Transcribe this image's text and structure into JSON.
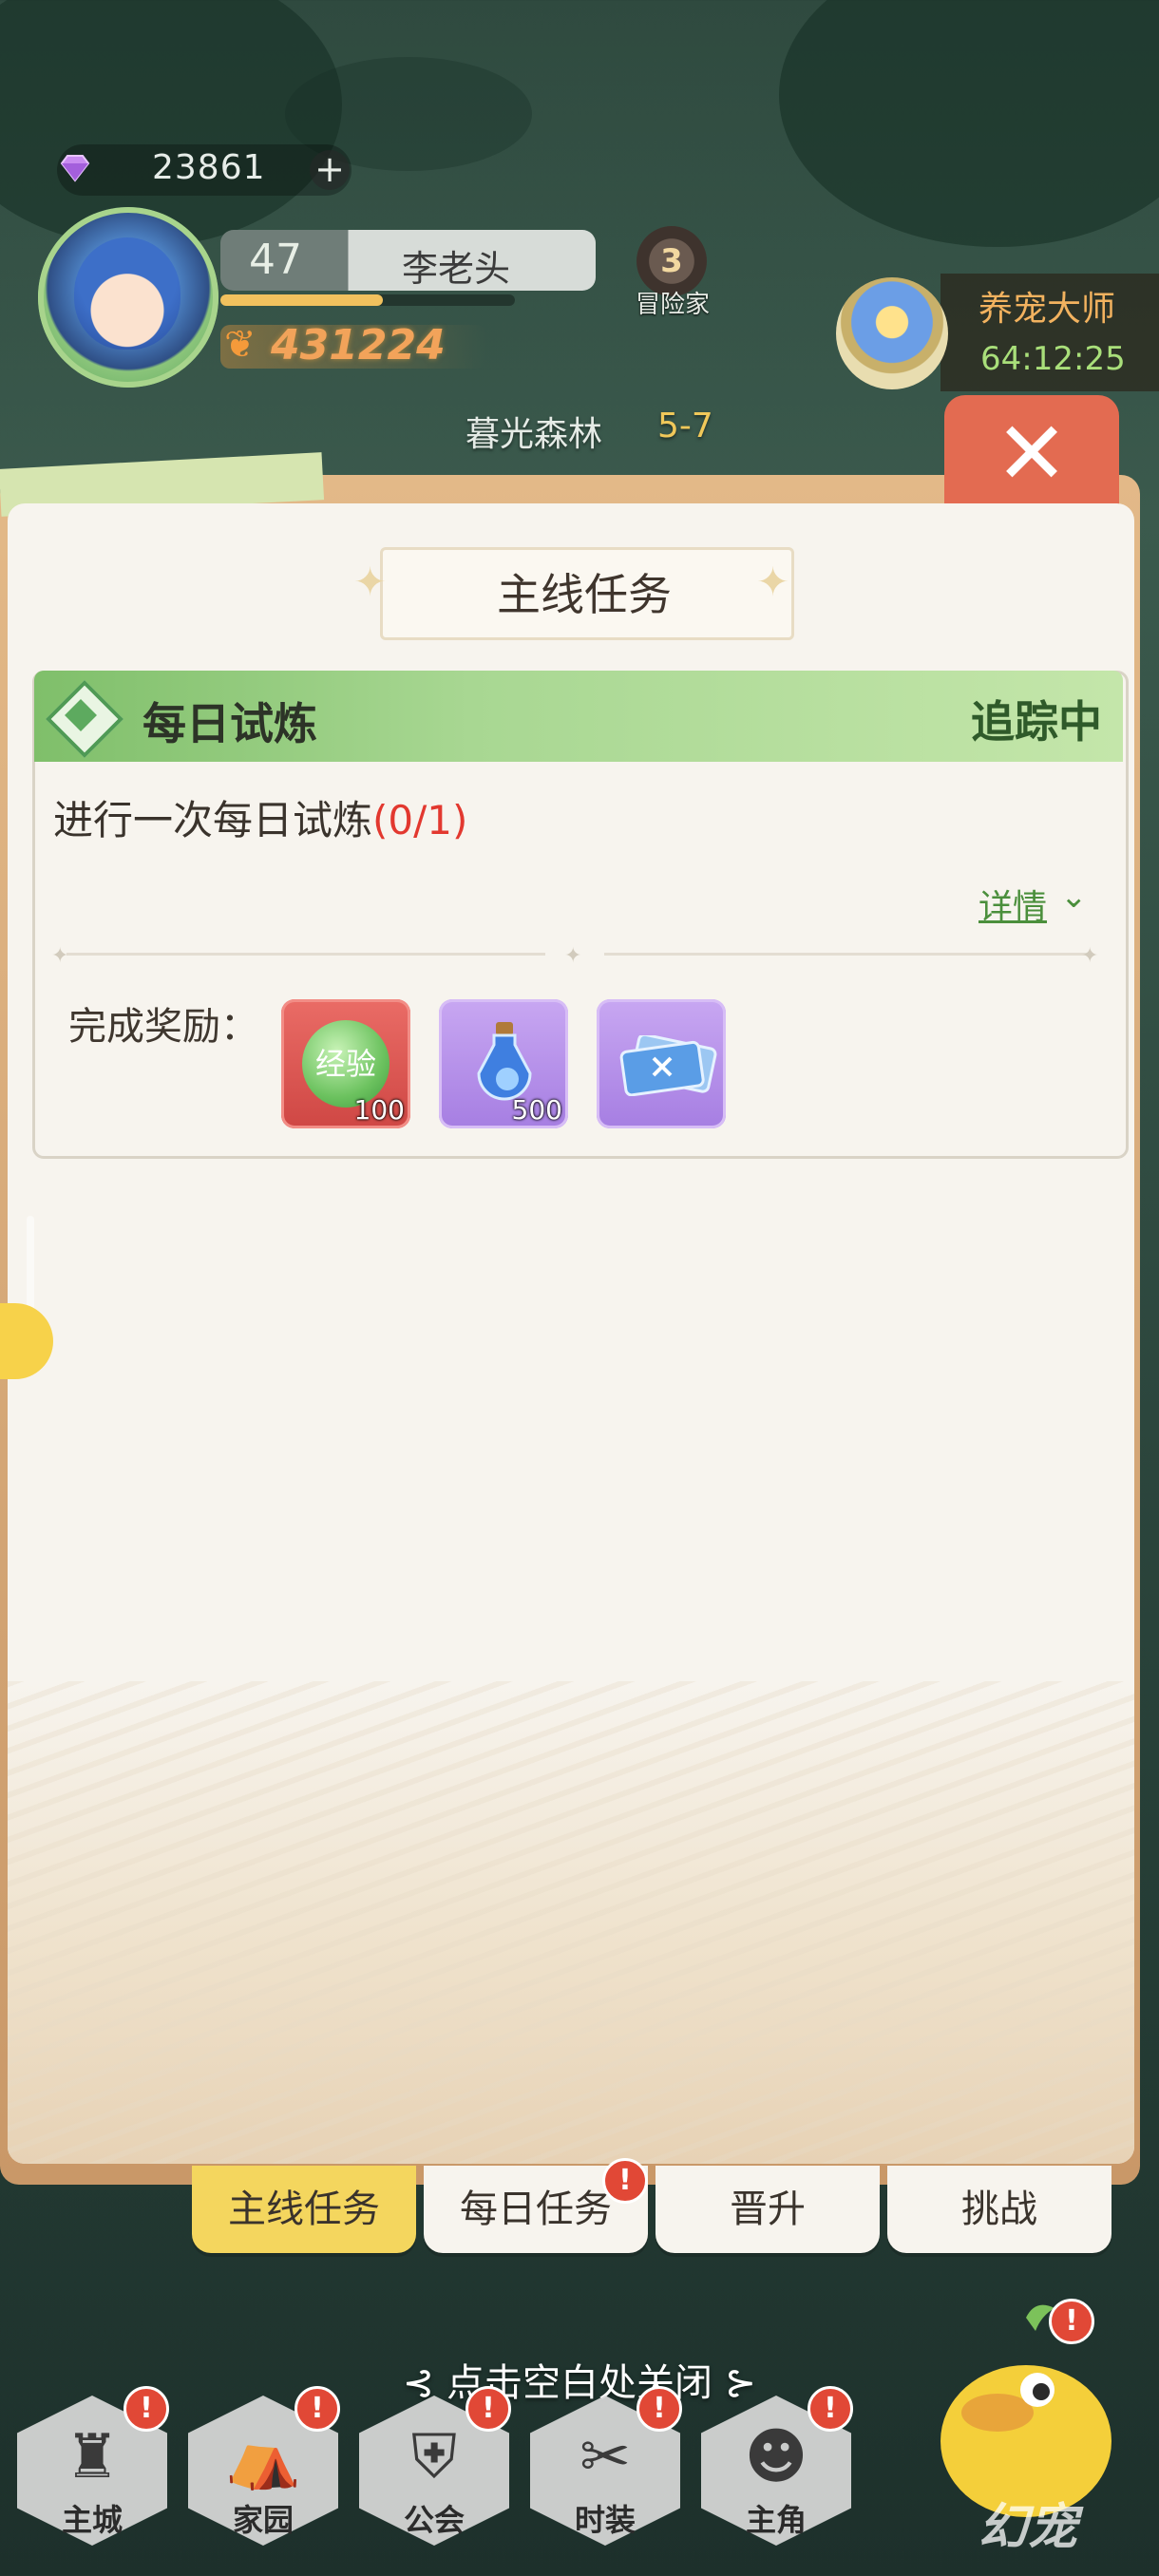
{
  "hud": {
    "gems": "23861",
    "plus": "+",
    "level": "47",
    "player_name": "李老头",
    "exp_fraction": 0.55,
    "power": "431224",
    "badge_number": "3",
    "badge_label": "冒险家",
    "stage_name": "暮光森林",
    "stage_num": "5-7"
  },
  "pet_event": {
    "title": "养宠大师",
    "timer": "64:12:25"
  },
  "close_button": "✕",
  "panel": {
    "title": "主线任务",
    "quest": {
      "name": "每日试炼",
      "status": "追踪中",
      "description": "进行一次每日试炼",
      "progress": "(0/1)",
      "details": "详情",
      "reward_label": "完成奖励：",
      "rewards": [
        {
          "icon": "exp-orb-icon",
          "text": "经验",
          "qty": "100",
          "color": "#e35d58"
        },
        {
          "icon": "potion-icon",
          "qty": "500",
          "color": "#b58de8"
        },
        {
          "icon": "ticket-icon",
          "color": "#b58de8"
        }
      ]
    }
  },
  "tabs": [
    {
      "label": "主线任务",
      "active": true
    },
    {
      "label": "每日任务",
      "alert": true
    },
    {
      "label": "晋升"
    },
    {
      "label": "挑战"
    }
  ],
  "tap_to_close": "点击空白处关闭",
  "nav": [
    {
      "label": "主城",
      "icon": "castle-icon",
      "alert": true
    },
    {
      "label": "家园",
      "icon": "tent-icon",
      "alert": true
    },
    {
      "label": "公会",
      "icon": "guild-shield-icon",
      "alert": true
    },
    {
      "label": "时装",
      "icon": "outfit-icon",
      "alert": true
    },
    {
      "label": "主角",
      "icon": "hero-icon",
      "alert": true
    }
  ],
  "pet_button": {
    "label": "幻宠",
    "alert": true
  },
  "colors": {
    "accent_green": "#7fbf6a",
    "progress_red": "#e2382f",
    "close_red": "#e36b51",
    "tab_active": "#f4d65e"
  }
}
